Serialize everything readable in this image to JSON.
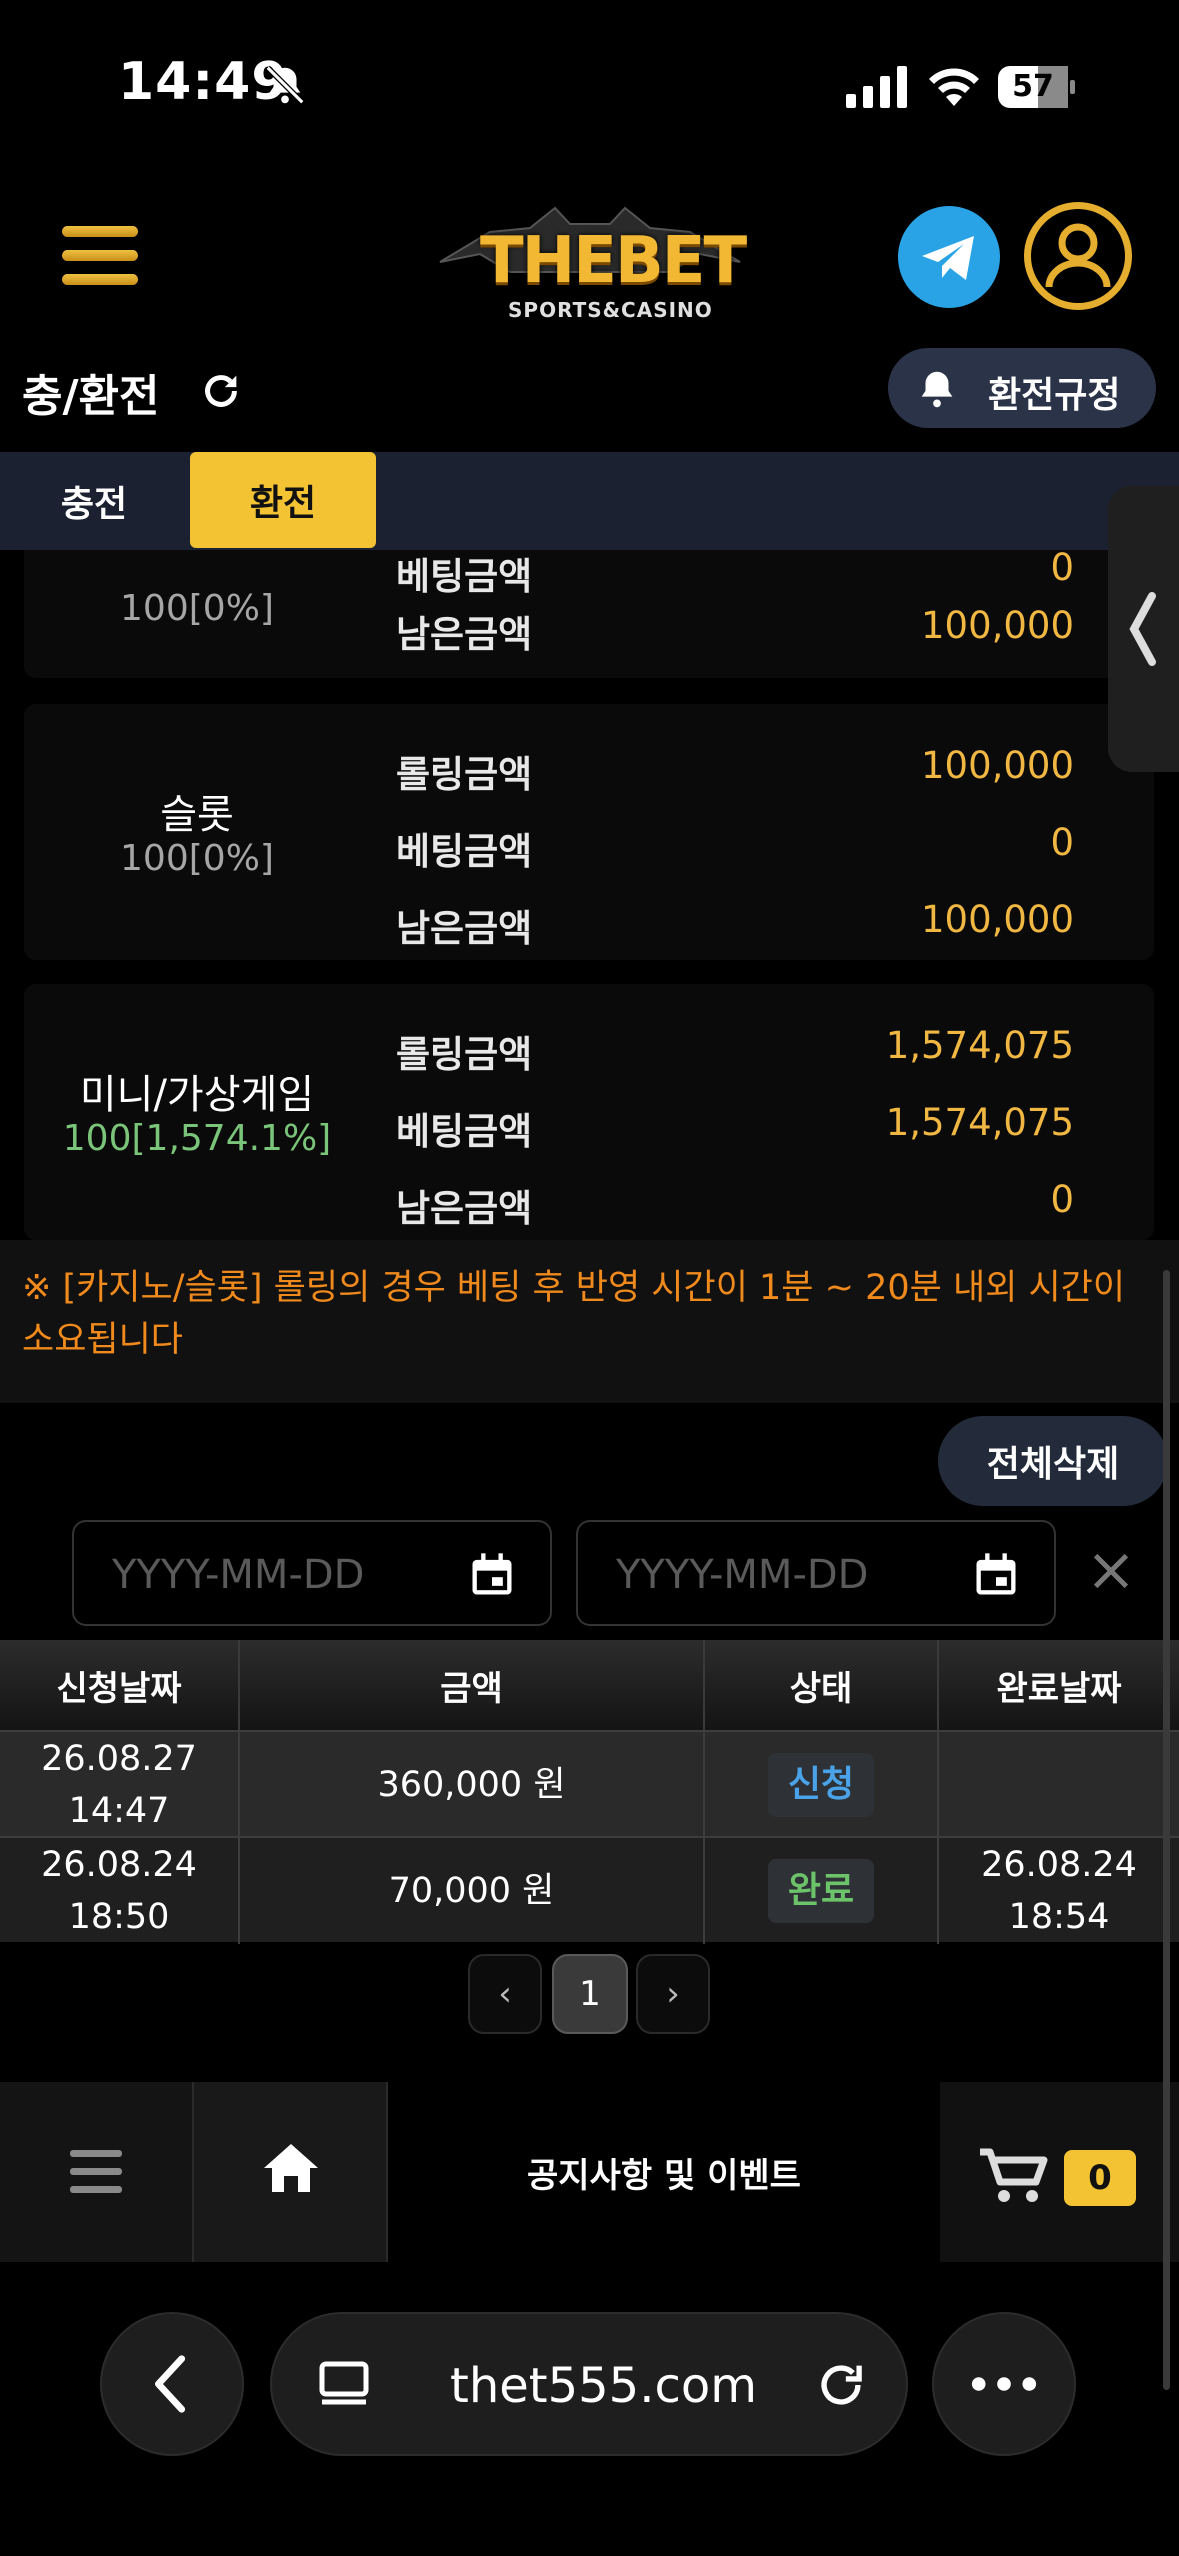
{
  "status_bar": {
    "time": "14:49",
    "battery": "57"
  },
  "header": {
    "logo_main": "THEBET",
    "logo_sub": "SPORTS&CASINO"
  },
  "page": {
    "title": "충/환전",
    "rules_button": "환전규정"
  },
  "tabs": [
    {
      "label": "충전",
      "active": false
    },
    {
      "label": "환전",
      "active": true
    }
  ],
  "rolling_cards": [
    {
      "name": "",
      "rate": "100[0%]",
      "rows": [
        {
          "label": "베팅금액",
          "value": "0"
        },
        {
          "label": "남은금액",
          "value": "100,000"
        }
      ]
    },
    {
      "name": "슬롯",
      "rate": "100[0%]",
      "rows": [
        {
          "label": "롤링금액",
          "value": "100,000"
        },
        {
          "label": "베팅금액",
          "value": "0"
        },
        {
          "label": "남은금액",
          "value": "100,000"
        }
      ]
    },
    {
      "name": "미니/가상게임",
      "rate": "100[1,574.1%]",
      "rows": [
        {
          "label": "롤링금액",
          "value": "1,574,075"
        },
        {
          "label": "베팅금액",
          "value": "1,574,075"
        },
        {
          "label": "남은금액",
          "value": "0"
        }
      ]
    }
  ],
  "notice_text": "※ [카지노/슬롯] 롤링의 경우 베팅 후 반영 시간이 1분 ~ 20분 내외 시간이 소요됩니다",
  "delete_all_label": "전체삭제",
  "date_filter": {
    "start_placeholder": "YYYY-MM-DD",
    "end_placeholder": "YYYY-MM-DD"
  },
  "table": {
    "headers": [
      "신청날짜",
      "금액",
      "상태",
      "완료날짜"
    ],
    "rows": [
      {
        "request_date": "26.08.27",
        "request_time": "14:47",
        "amount": "360,000 원",
        "status": "신청",
        "status_color": "#4aa3e8",
        "done_date": "",
        "done_time": ""
      },
      {
        "request_date": "26.08.24",
        "request_time": "18:50",
        "amount": "70,000 원",
        "status": "완료",
        "status_color": "#6cc36a",
        "done_date": "26.08.24",
        "done_time": "18:54"
      }
    ]
  },
  "pagination": {
    "prev": "‹",
    "current": "1",
    "next": "›"
  },
  "bottom_nav": {
    "notice_label": "공지사항 및 이벤트",
    "cart_count": "0"
  },
  "browser": {
    "url": "thet555.com"
  },
  "colors": {
    "accent": "#f3c333",
    "value_gold": "#f1b743",
    "notice_orange": "#f08a1c",
    "telegram": "#2aa3e6"
  }
}
